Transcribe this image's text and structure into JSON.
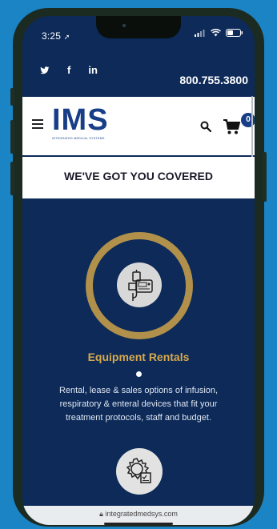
{
  "status": {
    "time": "3:25"
  },
  "header": {
    "social": [
      "twitter-icon",
      "facebook-icon",
      "linkedin-icon"
    ],
    "phone": "800.755.3800"
  },
  "nav": {
    "logo": "IMS",
    "logo_tagline": "INTEGRATED MEDICAL SYSTEMS",
    "cart_count": "0"
  },
  "banner": {
    "text": "WE'VE GOT YOU COVERED"
  },
  "service": {
    "title": "Equipment Rentals",
    "description": "Rental, lease & sales options of infusion, respiratory & enteral devices that fit your treatment protocols, staff and budget."
  },
  "browser": {
    "url": "integratedmedsys.com"
  },
  "colors": {
    "background": "#1b84c4",
    "page": "#0d2a58",
    "brand_blue": "#173e86",
    "gold": "#b0904a",
    "title_gold": "#d7a94e"
  }
}
